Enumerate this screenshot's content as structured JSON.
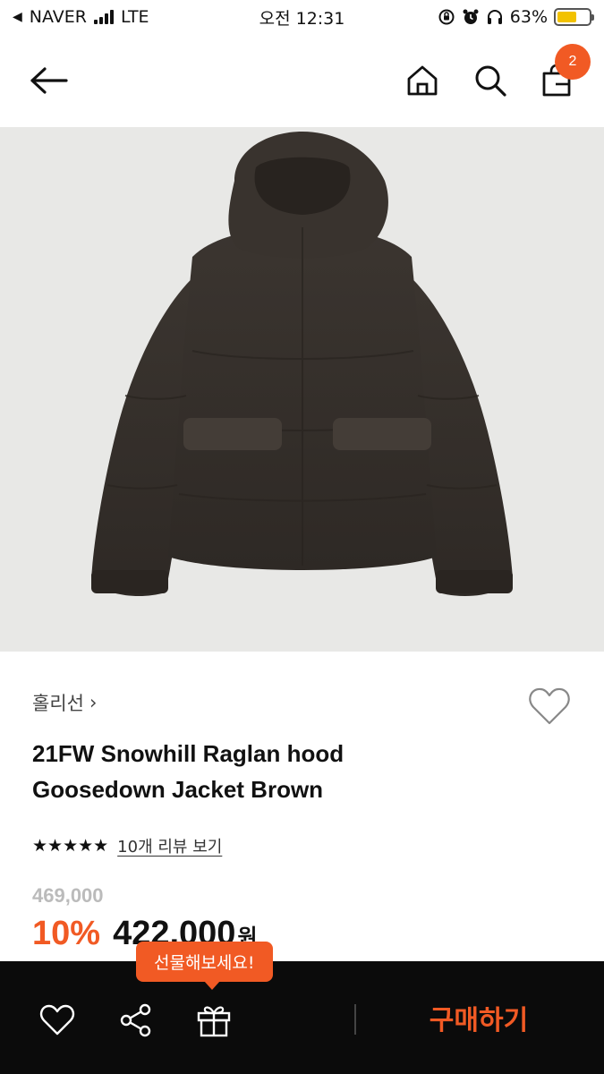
{
  "status_bar": {
    "carrier": "NAVER",
    "network": "LTE",
    "time": "오전 12:31",
    "battery_percent": "63%",
    "battery_level": 0.63
  },
  "header": {
    "cart_count": "2"
  },
  "product": {
    "brand": "홀리선",
    "brand_arrow": "›",
    "title_line1": "21FW Snowhill Raglan hood",
    "title_line2": "Goosedown Jacket Brown",
    "stars": "★★★★★",
    "rating": 5,
    "review_link": "10개 리뷰 보기",
    "original_price": "469,000",
    "discount": "10%",
    "sale_price": "422,000",
    "currency": "원"
  },
  "bottom_bar": {
    "gift_tooltip": "선물해보세요!",
    "buy_label": "구매하기"
  },
  "colors": {
    "accent": "#f15a24",
    "bottom_bar_bg": "#0b0b0b",
    "image_bg": "#e8e8e6",
    "jacket": "#3d3631"
  },
  "icons": {
    "back": "arrow-left-icon",
    "home": "home-icon",
    "search": "search-icon",
    "cart": "shopping-bag-icon",
    "wish": "heart-outline-icon",
    "like": "heart-outline-icon",
    "share": "share-icon",
    "gift": "gift-icon"
  }
}
